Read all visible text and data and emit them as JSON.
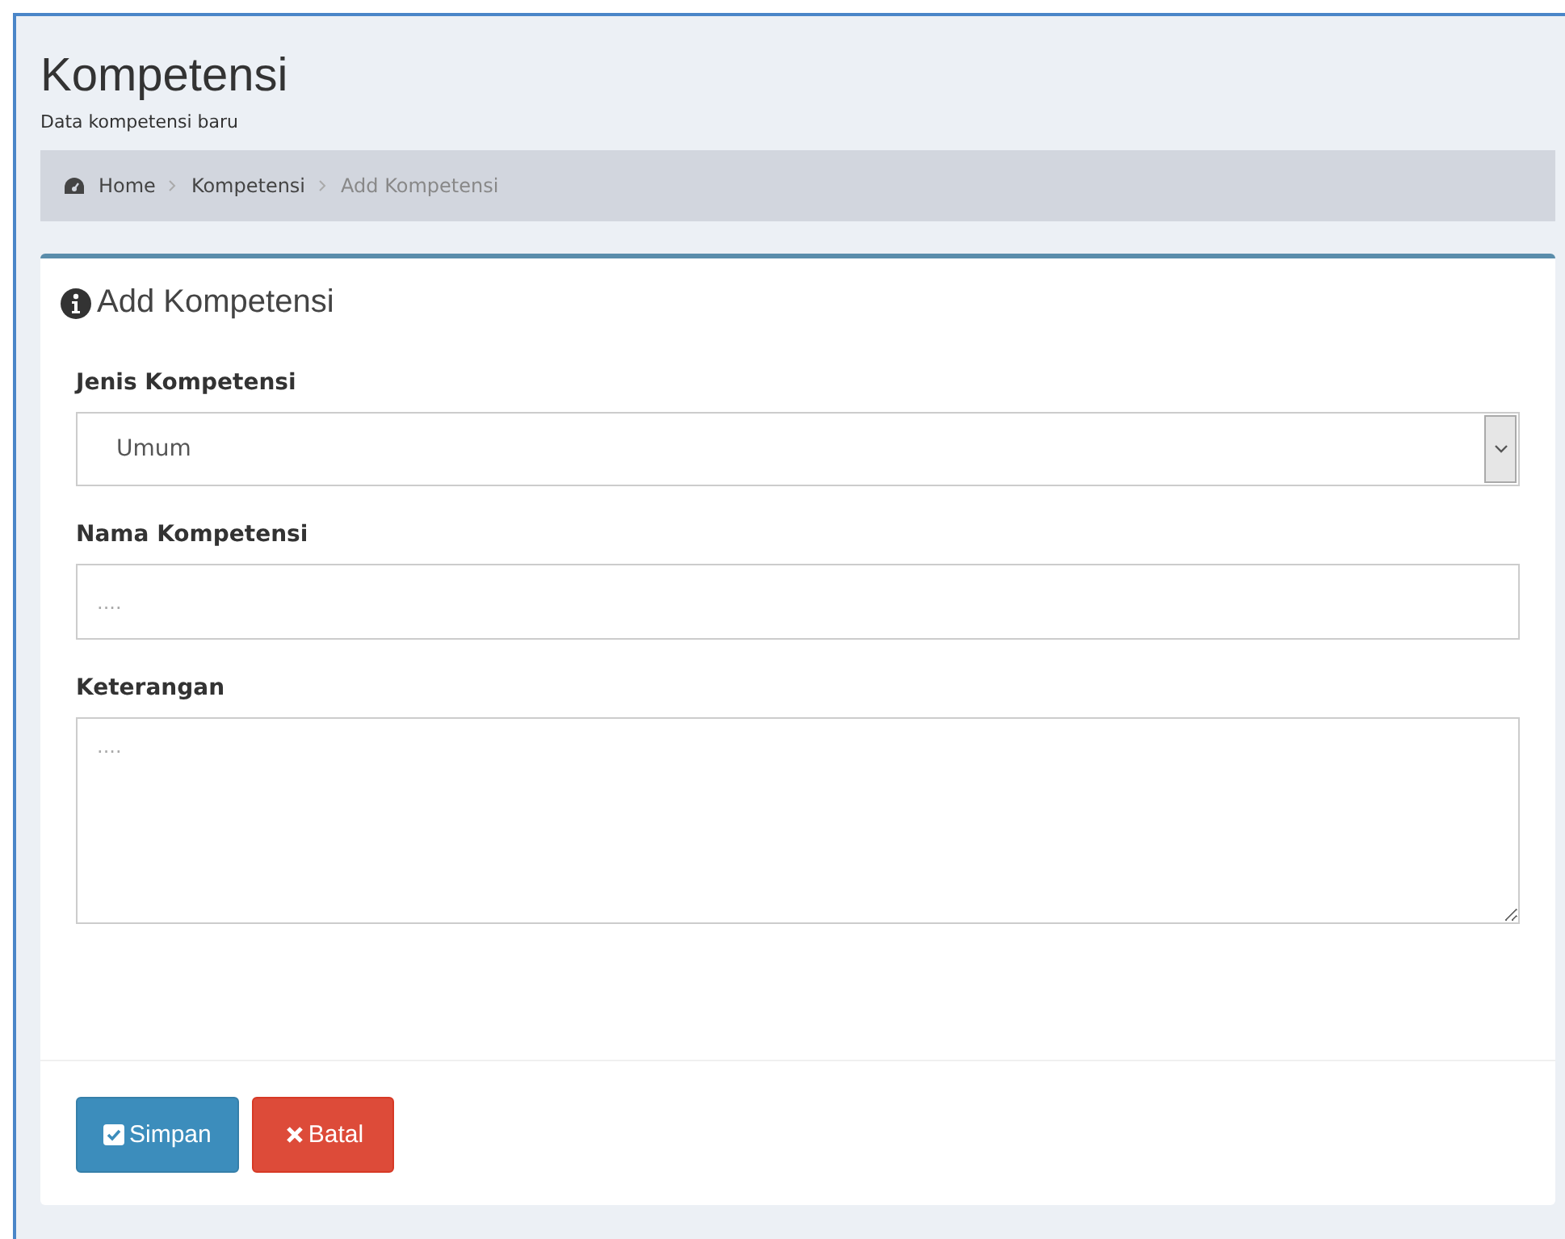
{
  "page": {
    "title": "Kompetensi",
    "subtitle": "Data kompetensi baru"
  },
  "breadcrumb": [
    {
      "label": "Home",
      "current": false
    },
    {
      "label": "Kompetensi",
      "current": false
    },
    {
      "label": "Add Kompetensi",
      "current": true
    }
  ],
  "box": {
    "title": "Add Kompetensi"
  },
  "fields": [
    {
      "kind": "select",
      "label": "Jenis Kompetensi",
      "value": "Umum"
    },
    {
      "kind": "text",
      "label": "Nama Kompetensi",
      "placeholder": "...."
    },
    {
      "kind": "textarea",
      "label": "Keterangan",
      "placeholder": "...."
    }
  ],
  "buttons": [
    {
      "kind": "primary",
      "label": "Simpan"
    },
    {
      "kind": "danger",
      "label": "Batal"
    }
  ]
}
